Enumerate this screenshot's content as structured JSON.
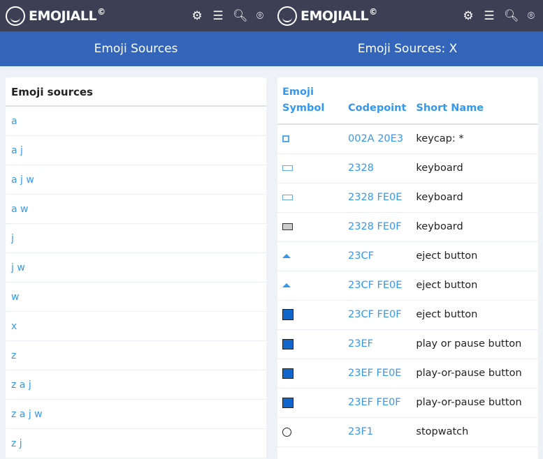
{
  "brand": "EMOJIALL",
  "brand_mark": "©",
  "header_icons": [
    "sliders-icon",
    "menu-icon",
    "search-icon",
    "location-pin-icon"
  ],
  "colors": {
    "topbar": "#3d3f55",
    "banner": "#3366bb",
    "link": "#3399ee"
  },
  "left": {
    "banner_title": "Emoji Sources",
    "card_title": "Emoji sources",
    "items": [
      "a",
      "a j",
      "a j w",
      "a w",
      "j",
      "j w",
      "w",
      "x",
      "z",
      "z a j",
      "z a j w",
      "z j"
    ]
  },
  "right": {
    "banner_title": "Emoji Sources: X",
    "columns": [
      "Emoji Symbol",
      "Codepoint",
      "Short Name"
    ],
    "rows": [
      {
        "icon": "keycap-asterisk-icon",
        "codepoint": "002A 20E3",
        "name": "keycap: *"
      },
      {
        "icon": "keyboard-icon",
        "codepoint": "2328",
        "name": "keyboard"
      },
      {
        "icon": "keyboard-icon",
        "codepoint": "2328 FE0E",
        "name": "keyboard"
      },
      {
        "icon": "keyboard-icon",
        "codepoint": "2328 FE0F",
        "name": "keyboard"
      },
      {
        "icon": "eject-icon",
        "codepoint": "23CF",
        "name": "eject button"
      },
      {
        "icon": "eject-icon",
        "codepoint": "23CF FE0E",
        "name": "eject button"
      },
      {
        "icon": "eject-button-icon",
        "codepoint": "23CF FE0F",
        "name": "eject button"
      },
      {
        "icon": "play-pause-icon",
        "codepoint": "23EF",
        "name": "play or pause button"
      },
      {
        "icon": "play-pause-icon",
        "codepoint": "23EF FE0E",
        "name": "play-or-pause button"
      },
      {
        "icon": "play-pause-icon",
        "codepoint": "23EF FE0F",
        "name": "play-or-pause button"
      },
      {
        "icon": "stopwatch-icon",
        "codepoint": "23F1",
        "name": "stopwatch"
      }
    ]
  }
}
